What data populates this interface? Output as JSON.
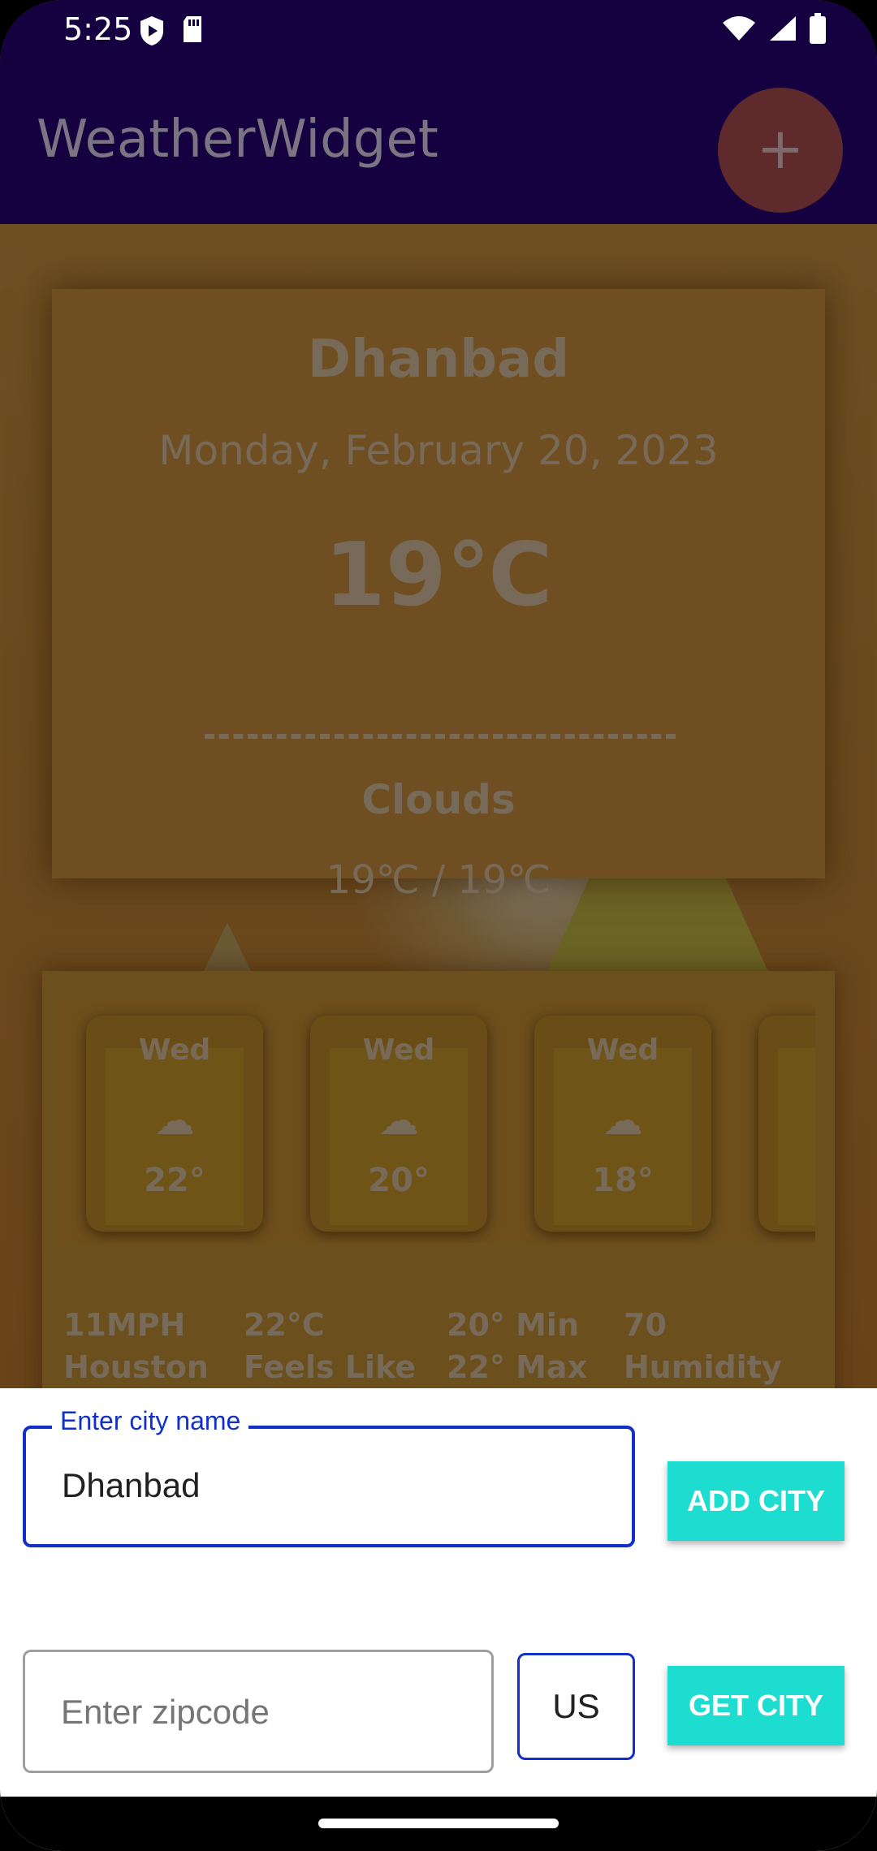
{
  "status_bar": {
    "time": "5:25",
    "left_icons": [
      "play-protect-icon",
      "sd-card-icon"
    ],
    "right_icons": [
      "wifi-icon",
      "signal-icon",
      "battery-icon"
    ]
  },
  "app_bar": {
    "title": "WeatherWidget",
    "fab_label": "+"
  },
  "weather": {
    "city": "Dhanbad",
    "date": "Monday, February 20, 2023",
    "temperature": "19℃",
    "condition": "Clouds",
    "range": "19℃ / 19℃"
  },
  "forecast": [
    {
      "day": "Wed",
      "icon": "cloudy-icon",
      "temp": "22°"
    },
    {
      "day": "Wed",
      "icon": "cloudy-icon",
      "temp": "20°"
    },
    {
      "day": "Wed",
      "icon": "cloudy-icon",
      "temp": "18°"
    }
  ],
  "stats": {
    "wind_value": "11MPH",
    "wind_label": "Houston",
    "feels_value": "22°C",
    "feels_label": "Feels Like",
    "min_value": "20° Min",
    "max_value": "22° Max",
    "humidity_value": "70",
    "humidity_label": "Humidity"
  },
  "sheet": {
    "city_field_label": "Enter city name",
    "city_field_value": "Dhanbad",
    "add_city_button": "ADD CITY",
    "zip_placeholder": "Enter zipcode",
    "country_value": "US",
    "get_city_button": "GET CITY"
  },
  "colors": {
    "app_bar": "#15013f",
    "accent_button": "#1ddcd0",
    "focused_field": "#1230c9"
  }
}
